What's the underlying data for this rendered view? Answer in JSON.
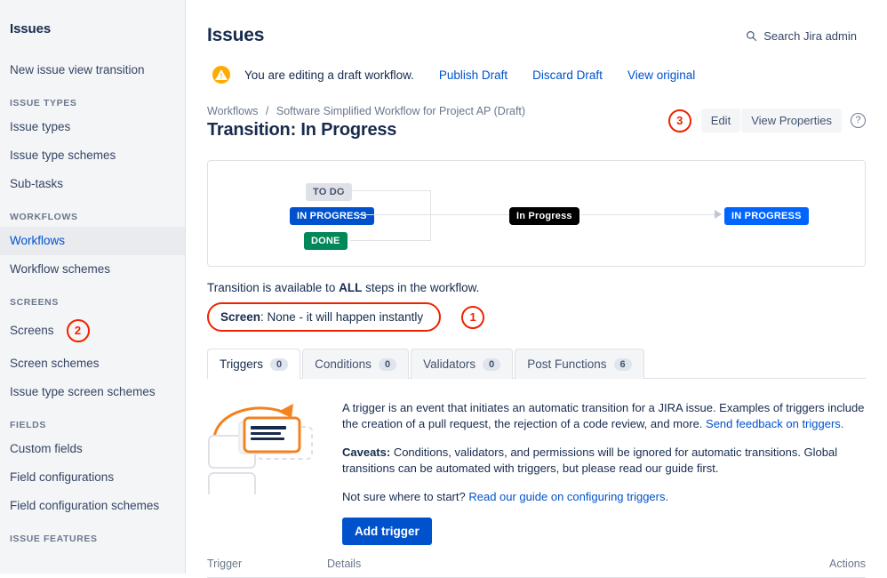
{
  "sidebar": {
    "title": "Issues",
    "groups": [
      {
        "label": null,
        "items": [
          {
            "label": "New issue view transition",
            "active": false
          }
        ]
      },
      {
        "label": "ISSUE TYPES",
        "items": [
          {
            "label": "Issue types",
            "active": false
          },
          {
            "label": "Issue type schemes",
            "active": false
          },
          {
            "label": "Sub-tasks",
            "active": false
          }
        ]
      },
      {
        "label": "WORKFLOWS",
        "items": [
          {
            "label": "Workflows",
            "active": true
          },
          {
            "label": "Workflow schemes",
            "active": false
          }
        ]
      },
      {
        "label": "SCREENS",
        "items": [
          {
            "label": "Screens",
            "active": false,
            "annotation": "2"
          },
          {
            "label": "Screen schemes",
            "active": false
          },
          {
            "label": "Issue type screen schemes",
            "active": false
          }
        ]
      },
      {
        "label": "FIELDS",
        "items": [
          {
            "label": "Custom fields",
            "active": false
          },
          {
            "label": "Field configurations",
            "active": false
          },
          {
            "label": "Field configuration schemes",
            "active": false
          }
        ]
      },
      {
        "label": "ISSUE FEATURES",
        "items": []
      }
    ]
  },
  "header": {
    "title": "Issues",
    "search_label": "Search Jira admin",
    "search_icon": "search-icon"
  },
  "banner": {
    "icon": "warning-icon",
    "text": "You are editing a draft workflow.",
    "links": [
      "Publish Draft",
      "Discard Draft",
      "View original"
    ]
  },
  "breadcrumb": {
    "root": "Workflows",
    "separator": "/",
    "current": "Software Simplified Workflow for Project AP (Draft)"
  },
  "page": {
    "title": "Transition: In Progress",
    "edit_label": "Edit",
    "view_properties_label": "View Properties",
    "help_icon": "help-circle-icon",
    "annotation_3": "3"
  },
  "diagram": {
    "source_statuses": [
      {
        "label": "TO DO",
        "style": "todo"
      },
      {
        "label": "IN PROGRESS",
        "style": "blue"
      },
      {
        "label": "DONE",
        "style": "green"
      }
    ],
    "transition_label": "In Progress",
    "target_status": "IN PROGRESS"
  },
  "availability": {
    "prefix": "Transition is available to ",
    "strong": "ALL",
    "suffix": " steps in the workflow."
  },
  "screen": {
    "label": "Screen",
    "value": ": None - it will happen instantly",
    "annotation_1": "1"
  },
  "tabs": [
    {
      "label": "Triggers",
      "count": "0",
      "active": true
    },
    {
      "label": "Conditions",
      "count": "0",
      "active": false
    },
    {
      "label": "Validators",
      "count": "0",
      "active": false
    },
    {
      "label": "Post Functions",
      "count": "6",
      "active": false
    }
  ],
  "trigger_panel": {
    "illustration": "drag-drop-trigger-illustration",
    "para1_text": "A trigger is an event that initiates an automatic transition for a JIRA issue. Examples of triggers include the creation of a pull request, the rejection of a code review, and more. ",
    "para1_link": "Send feedback on triggers.",
    "para2_strong": "Caveats:",
    "para2_text": " Conditions, validators, and permissions will be ignored for automatic transitions. Global transitions can be automated with triggers, but please read our guide first.",
    "para3_text": "Not sure where to start? ",
    "para3_link": "Read our guide on configuring triggers.",
    "add_button": "Add trigger"
  },
  "table": {
    "columns": [
      "Trigger",
      "Details",
      "Actions"
    ]
  },
  "colors": {
    "accent_blue": "#0052cc",
    "annotation_red": "#ef2200",
    "warning_yellow": "#ffab00",
    "status_green": "#00875a",
    "bright_blue": "#0065ff"
  }
}
